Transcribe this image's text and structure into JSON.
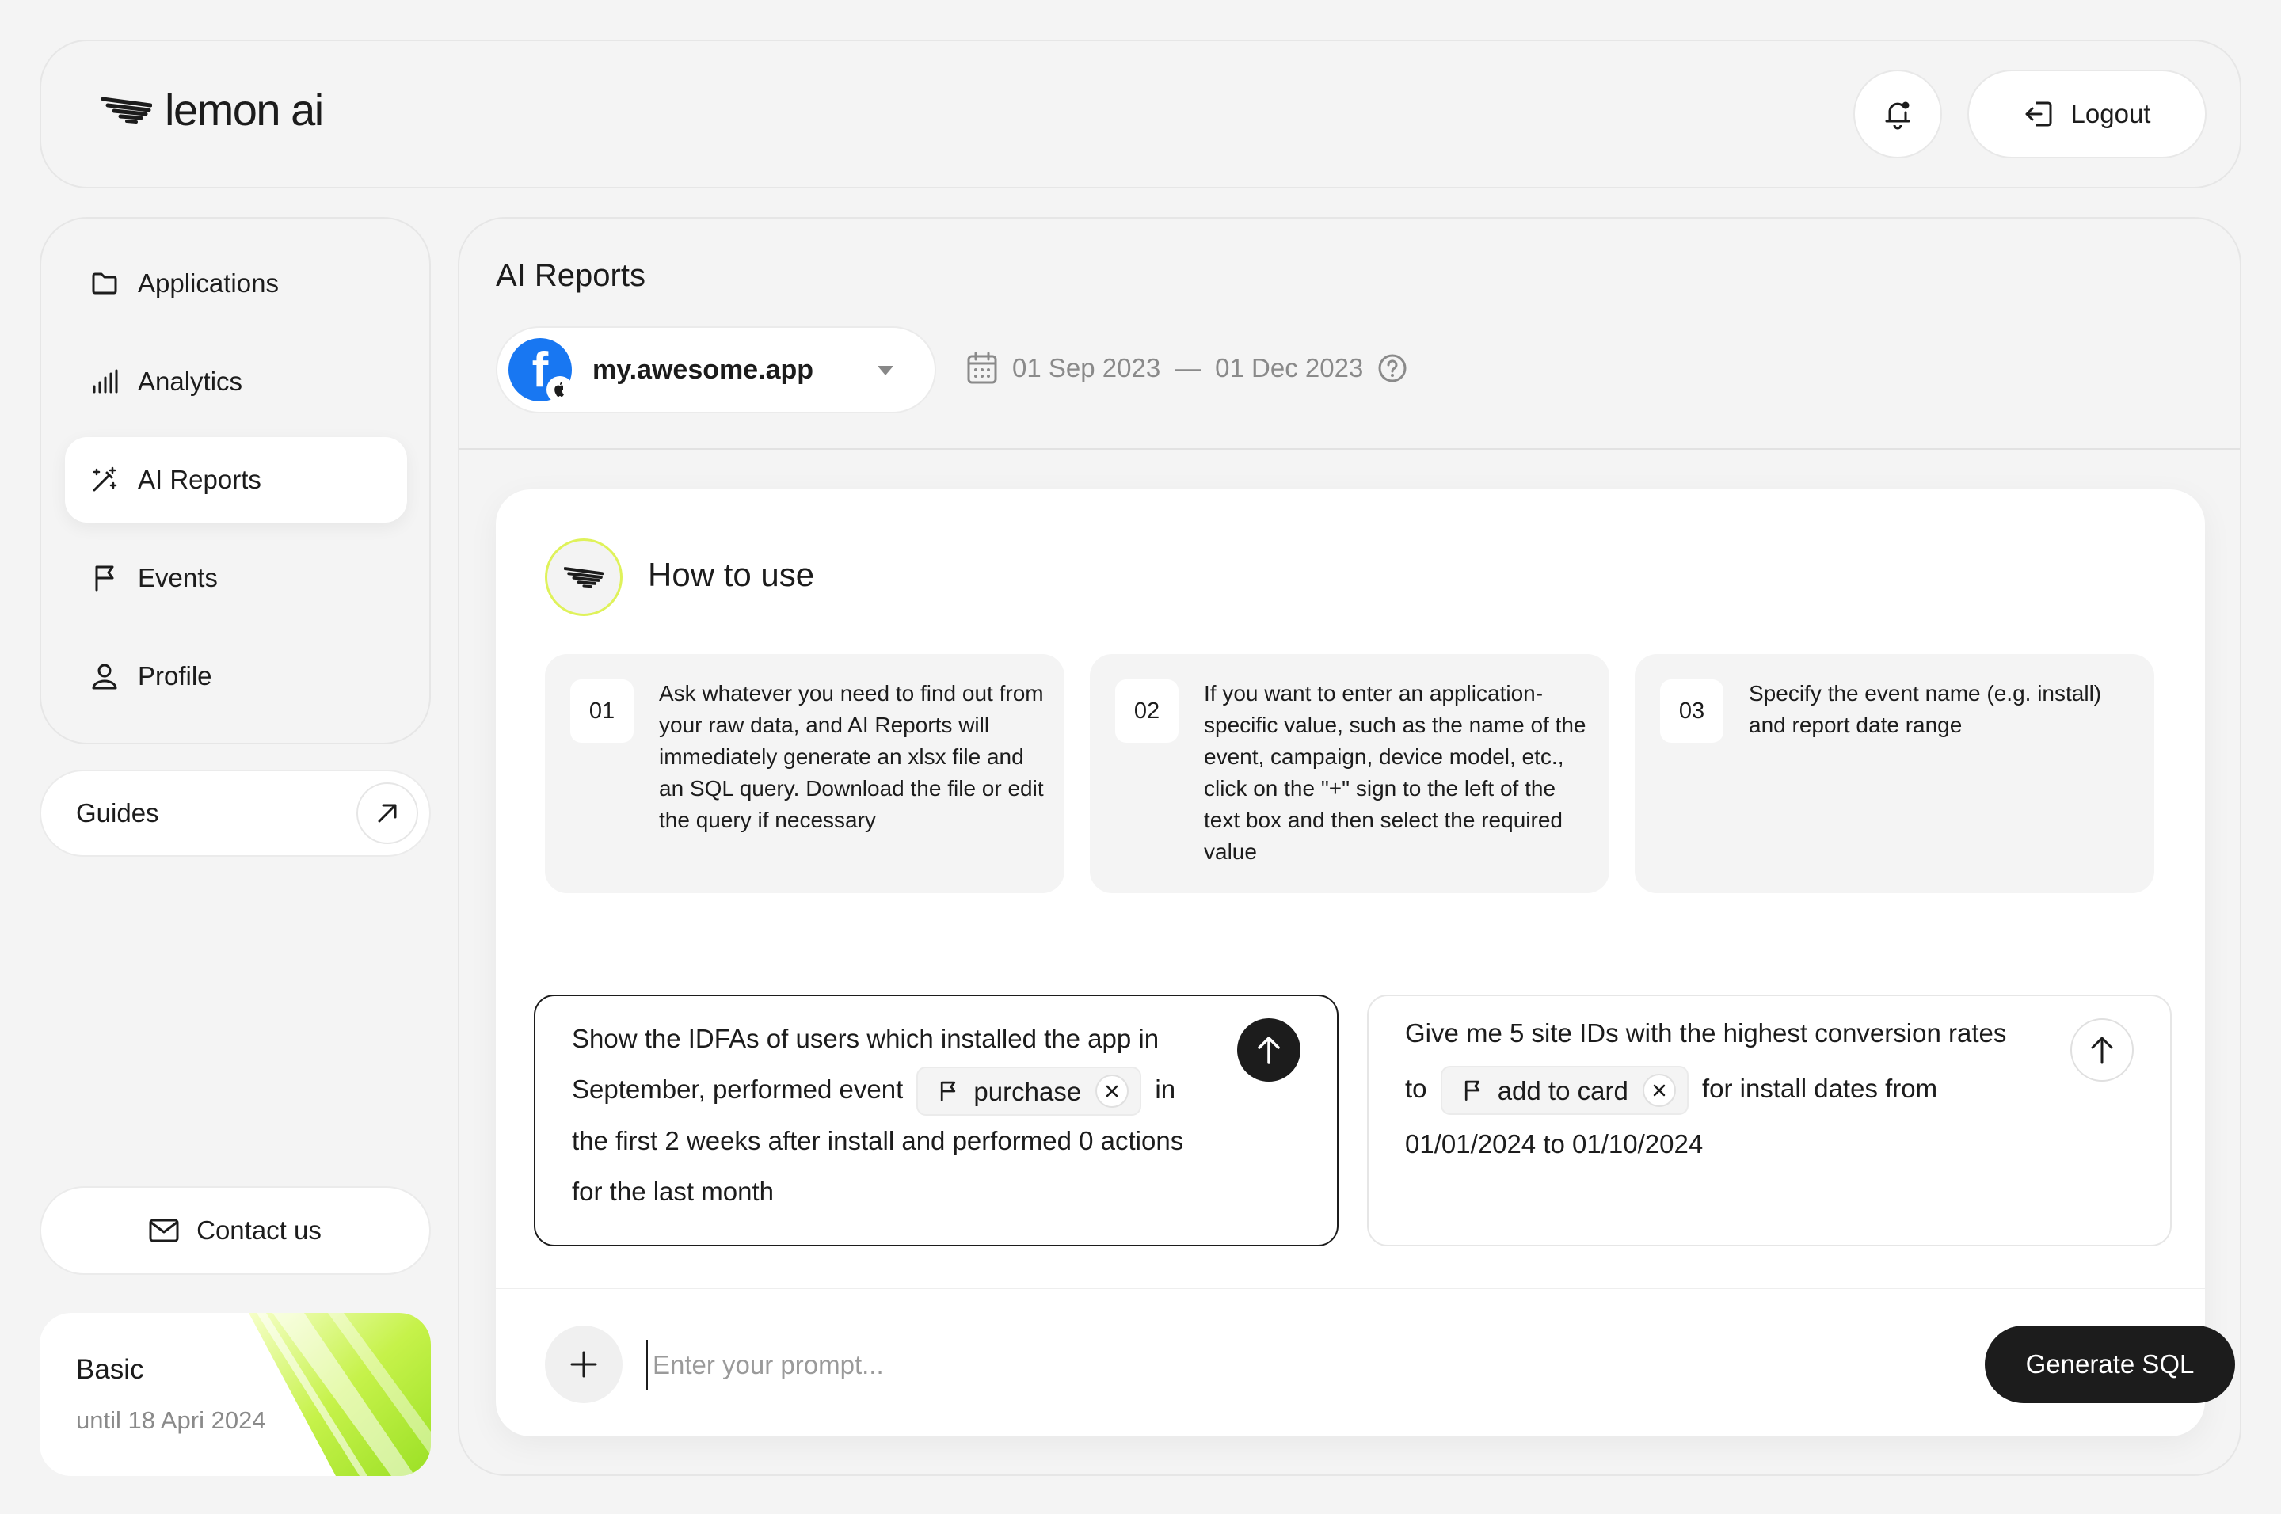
{
  "brand": {
    "name": "lemon ai"
  },
  "header": {
    "logout_label": "Logout"
  },
  "sidebar": {
    "items": [
      {
        "label": "Applications",
        "icon": "folder-icon"
      },
      {
        "label": "Analytics",
        "icon": "bar-chart-icon"
      },
      {
        "label": "AI Reports",
        "icon": "magic-wand-icon",
        "active": true
      },
      {
        "label": "Events",
        "icon": "flag-icon"
      },
      {
        "label": "Profile",
        "icon": "user-icon"
      }
    ],
    "guides_label": "Guides",
    "contact_label": "Contact us",
    "plan": {
      "name": "Basic",
      "until": "until 18 Apri 2024"
    }
  },
  "main": {
    "title": "AI Reports",
    "app_select": {
      "value": "my.awesome.app"
    },
    "date_range": {
      "start": "01 Sep 2023",
      "separator": "—",
      "end": "01 Dec 2023"
    }
  },
  "how_to": {
    "title": "How to use",
    "steps": [
      {
        "num": "01",
        "text": "Ask whatever you need to find out from your raw data, and AI Reports will immediately generate an xlsx file and an SQL query. Download the file or edit the query if necessary"
      },
      {
        "num": "02",
        "text": "If you want to enter an application-specific value, such as the name of the event, campaign, device model, etc., click on the \"+\" sign to the left of the text box and then select the required value"
      },
      {
        "num": "03",
        "text": "Specify the event name (e.g. install) and report date range"
      }
    ]
  },
  "examples": [
    {
      "before": "Show the IDFAs of users which installed the app in September, performed event",
      "chip": "purchase",
      "after": "in the first 2 weeks after install and performed 0 actions for the last month"
    },
    {
      "before": "Give me 5 site IDs with the highest conversion rates to",
      "chip": "add to card",
      "after": "for install dates from  01/01/2024 to 01/10/2024"
    }
  ],
  "prompt": {
    "placeholder": "Enter your prompt...",
    "generate_label": "Generate SQL"
  },
  "colors": {
    "accent": "#dff25a",
    "dark": "#1c1c1c",
    "facebook": "#1877f2",
    "background": "#f4f4f4"
  }
}
